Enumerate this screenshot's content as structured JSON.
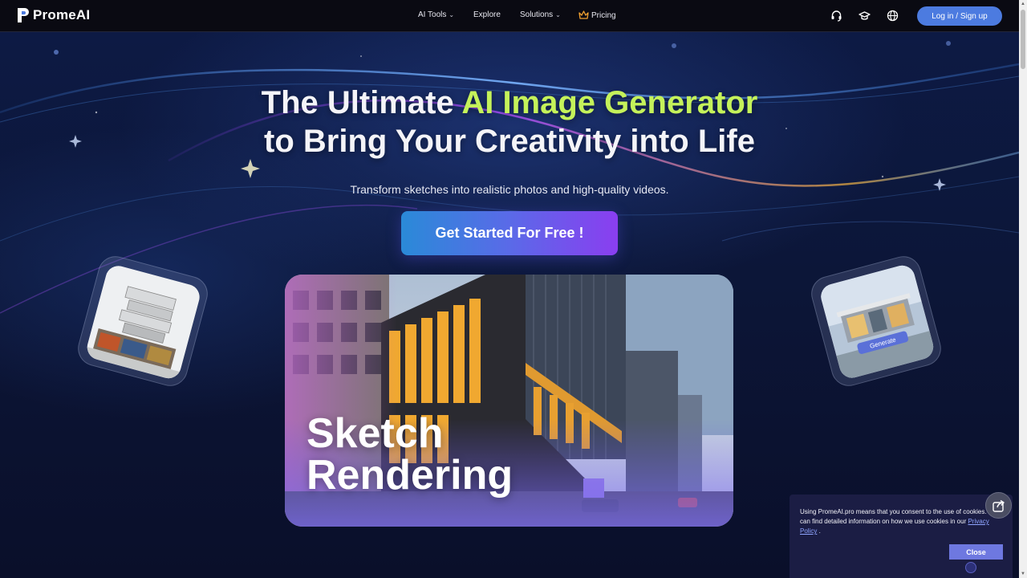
{
  "nav": {
    "logo_text": "PromeAI",
    "links": [
      {
        "label": "AI Tools",
        "has_dropdown": true
      },
      {
        "label": "Explore",
        "has_dropdown": false
      },
      {
        "label": "Solutions",
        "has_dropdown": true
      },
      {
        "label": "Pricing",
        "icon": "crown-icon"
      }
    ],
    "icons": [
      "headset-icon",
      "graduation-cap-icon",
      "globe-icon"
    ],
    "login_label": "Log in / Sign up"
  },
  "hero": {
    "headline_pre": "The Ultimate ",
    "headline_accent": "AI Image Generator",
    "headline_line2": "to Bring Your Creativity into Life",
    "subtitle": "Transform sketches into realistic photos and high-quality videos.",
    "cta_label": "Get Started For Free !",
    "card_title_line1": "Sketch",
    "card_title_line2": "Rendering",
    "side_right_badge": "Generate"
  },
  "cookie": {
    "text": "Using PromeAI.pro means that you consent to the use of cookies. You can find detailed information on how we use cookies in our",
    "link_label": "Privacy Policy",
    "text_end": " .",
    "close_label": "Close"
  },
  "colors": {
    "accent_green": "#c5f25a",
    "login_blue": "#4c7be0",
    "cookie_bg": "#1b1d44",
    "close_button": "#6e78e0"
  }
}
